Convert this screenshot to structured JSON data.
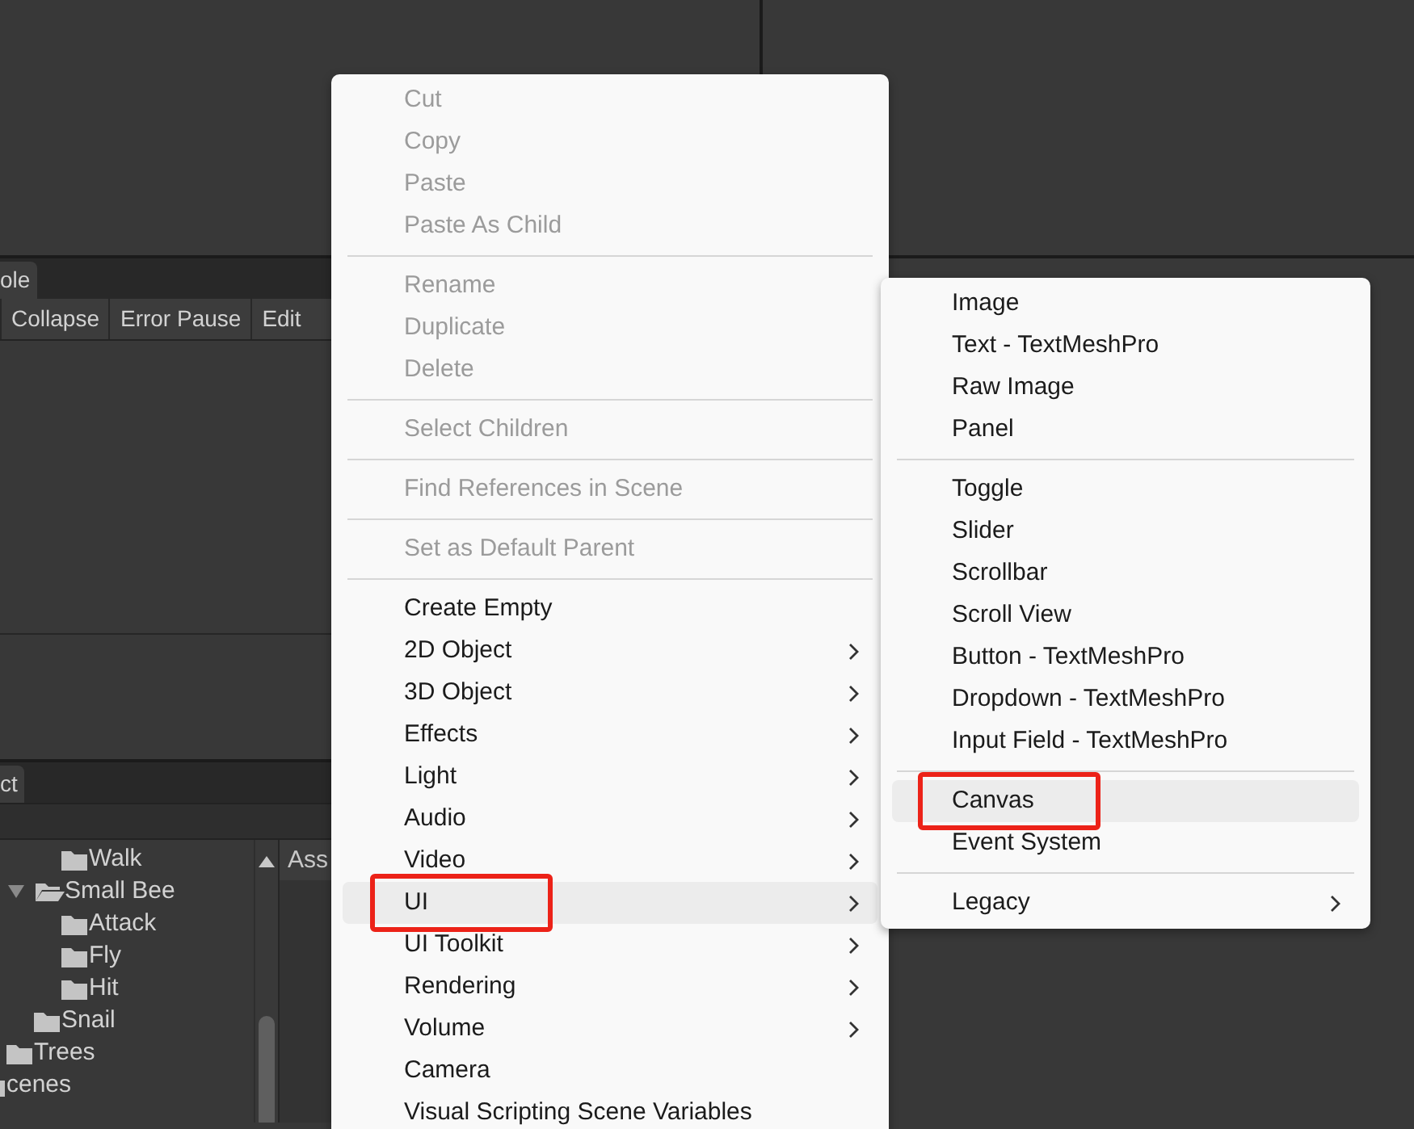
{
  "console_panel": {
    "tab": "ole",
    "toolbar_buttons": [
      "Collapse",
      "Error Pause",
      "Edit"
    ]
  },
  "project_panel": {
    "tab": "ct",
    "assets_header": "Ass",
    "tree": [
      {
        "children": [
          {
            "children": [
              {
                "children": [
                  {
                    "label": "Walk"
                  }
                ]
              },
              {
                "label": "Small Bee",
                "expanded": true,
                "children": [
                  {
                    "label": "Attack"
                  },
                  {
                    "label": "Fly"
                  },
                  {
                    "label": "Hit"
                  }
                ]
              },
              {
                "label": "Snail"
              }
            ]
          },
          {
            "label": "Trees"
          }
        ]
      },
      {
        "label": "cenes"
      }
    ]
  },
  "context_menu": {
    "items": [
      {
        "kind": "item",
        "label": "Cut",
        "disabled": true,
        "submenu": false,
        "selected": false,
        "annotated": false
      },
      {
        "kind": "item",
        "label": "Copy",
        "disabled": true,
        "submenu": false,
        "selected": false,
        "annotated": false
      },
      {
        "kind": "item",
        "label": "Paste",
        "disabled": true,
        "submenu": false,
        "selected": false,
        "annotated": false
      },
      {
        "kind": "item",
        "label": "Paste As Child",
        "disabled": true,
        "submenu": false,
        "selected": false,
        "annotated": false
      },
      {
        "kind": "separator"
      },
      {
        "kind": "item",
        "label": "Rename",
        "disabled": true,
        "submenu": false,
        "selected": false,
        "annotated": false
      },
      {
        "kind": "item",
        "label": "Duplicate",
        "disabled": true,
        "submenu": false,
        "selected": false,
        "annotated": false
      },
      {
        "kind": "item",
        "label": "Delete",
        "disabled": true,
        "submenu": false,
        "selected": false,
        "annotated": false
      },
      {
        "kind": "separator"
      },
      {
        "kind": "item",
        "label": "Select Children",
        "disabled": true,
        "submenu": false,
        "selected": false,
        "annotated": false
      },
      {
        "kind": "separator"
      },
      {
        "kind": "item",
        "label": "Find References in Scene",
        "disabled": true,
        "submenu": false,
        "selected": false,
        "annotated": false
      },
      {
        "kind": "separator"
      },
      {
        "kind": "item",
        "label": "Set as Default Parent",
        "disabled": true,
        "submenu": false,
        "selected": false,
        "annotated": false
      },
      {
        "kind": "separator"
      },
      {
        "kind": "item",
        "label": "Create Empty",
        "disabled": false,
        "submenu": false,
        "selected": false,
        "annotated": false
      },
      {
        "kind": "item",
        "label": "2D Object",
        "disabled": false,
        "submenu": true,
        "selected": false,
        "annotated": false
      },
      {
        "kind": "item",
        "label": "3D Object",
        "disabled": false,
        "submenu": true,
        "selected": false,
        "annotated": false
      },
      {
        "kind": "item",
        "label": "Effects",
        "disabled": false,
        "submenu": true,
        "selected": false,
        "annotated": false
      },
      {
        "kind": "item",
        "label": "Light",
        "disabled": false,
        "submenu": true,
        "selected": false,
        "annotated": false
      },
      {
        "kind": "item",
        "label": "Audio",
        "disabled": false,
        "submenu": true,
        "selected": false,
        "annotated": false
      },
      {
        "kind": "item",
        "label": "Video",
        "disabled": false,
        "submenu": true,
        "selected": false,
        "annotated": false
      },
      {
        "kind": "item",
        "label": "UI",
        "disabled": false,
        "submenu": true,
        "selected": true,
        "annotated": true
      },
      {
        "kind": "item",
        "label": "UI Toolkit",
        "disabled": false,
        "submenu": true,
        "selected": false,
        "annotated": false
      },
      {
        "kind": "item",
        "label": "Rendering",
        "disabled": false,
        "submenu": true,
        "selected": false,
        "annotated": false
      },
      {
        "kind": "item",
        "label": "Volume",
        "disabled": false,
        "submenu": true,
        "selected": false,
        "annotated": false
      },
      {
        "kind": "item",
        "label": "Camera",
        "disabled": false,
        "submenu": false,
        "selected": false,
        "annotated": false
      },
      {
        "kind": "item",
        "label": "Visual Scripting Scene Variables",
        "disabled": false,
        "submenu": false,
        "selected": false,
        "annotated": false
      }
    ]
  },
  "submenu": {
    "items": [
      {
        "kind": "item",
        "label": "Image",
        "disabled": false,
        "submenu": false,
        "selected": false,
        "annotated": false
      },
      {
        "kind": "item",
        "label": "Text - TextMeshPro",
        "disabled": false,
        "submenu": false,
        "selected": false,
        "annotated": false
      },
      {
        "kind": "item",
        "label": "Raw Image",
        "disabled": false,
        "submenu": false,
        "selected": false,
        "annotated": false
      },
      {
        "kind": "item",
        "label": "Panel",
        "disabled": false,
        "submenu": false,
        "selected": false,
        "annotated": false
      },
      {
        "kind": "separator"
      },
      {
        "kind": "item",
        "label": "Toggle",
        "disabled": false,
        "submenu": false,
        "selected": false,
        "annotated": false
      },
      {
        "kind": "item",
        "label": "Slider",
        "disabled": false,
        "submenu": false,
        "selected": false,
        "annotated": false
      },
      {
        "kind": "item",
        "label": "Scrollbar",
        "disabled": false,
        "submenu": false,
        "selected": false,
        "annotated": false
      },
      {
        "kind": "item",
        "label": "Scroll View",
        "disabled": false,
        "submenu": false,
        "selected": false,
        "annotated": false
      },
      {
        "kind": "item",
        "label": "Button - TextMeshPro",
        "disabled": false,
        "submenu": false,
        "selected": false,
        "annotated": false
      },
      {
        "kind": "item",
        "label": "Dropdown - TextMeshPro",
        "disabled": false,
        "submenu": false,
        "selected": false,
        "annotated": false
      },
      {
        "kind": "item",
        "label": "Input Field - TextMeshPro",
        "disabled": false,
        "submenu": false,
        "selected": false,
        "annotated": false
      },
      {
        "kind": "separator"
      },
      {
        "kind": "item",
        "label": "Canvas",
        "disabled": false,
        "submenu": false,
        "selected": true,
        "annotated": true
      },
      {
        "kind": "item",
        "label": "Event System",
        "disabled": false,
        "submenu": false,
        "selected": false,
        "annotated": false
      },
      {
        "kind": "separator"
      },
      {
        "kind": "item",
        "label": "Legacy",
        "disabled": false,
        "submenu": true,
        "selected": false,
        "annotated": false
      }
    ]
  }
}
